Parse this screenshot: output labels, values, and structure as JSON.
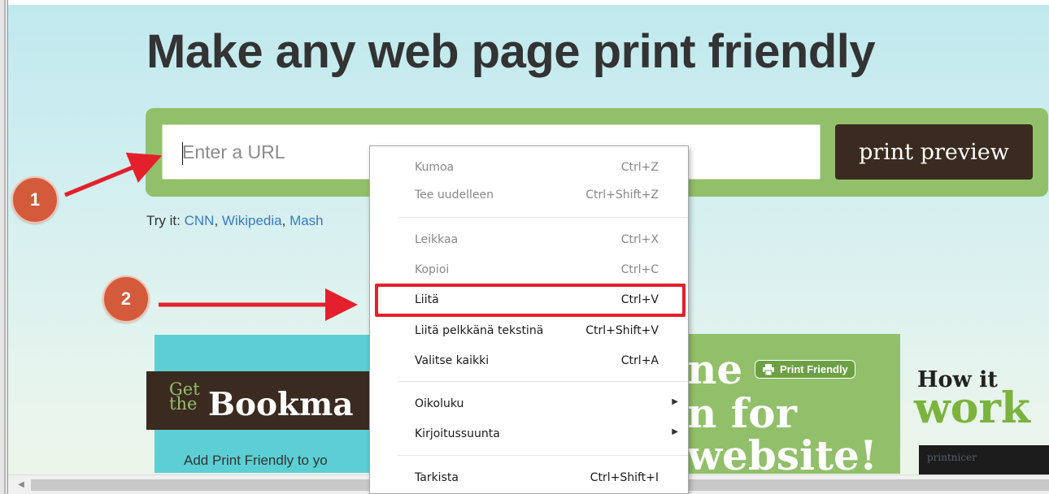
{
  "page": {
    "headline": "Make any web page print friendly",
    "url_input": {
      "placeholder": "Enter a URL",
      "value": ""
    },
    "print_preview_label": "print preview",
    "try_it": {
      "prefix": "Try it:",
      "links": [
        "CNN",
        "Wikipedia",
        "Mash"
      ],
      "separator": ", "
    }
  },
  "callouts": [
    {
      "number": "1"
    },
    {
      "number": "2"
    }
  ],
  "promos": {
    "bookmarklet": {
      "get": "Get",
      "the": "the",
      "title": "Bookma",
      "description": "Add Print Friendly to yo"
    },
    "green": {
      "line1": "ne",
      "line2": "n for",
      "line3": "website!",
      "badge": "Print Friendly",
      "badge_icon": "printer-icon"
    },
    "how_it_works": {
      "line1": "How it",
      "line2": "work",
      "strip_text": "printnicer"
    }
  },
  "context_menu": {
    "items": [
      {
        "label": "Kumoa",
        "shortcut": "Ctrl+Z",
        "disabled": true
      },
      {
        "label": "Tee uudelleen",
        "shortcut": "Ctrl+Shift+Z",
        "disabled": true
      },
      {
        "label": "Leikkaa",
        "shortcut": "Ctrl+X",
        "disabled": true
      },
      {
        "label": "Kopioi",
        "shortcut": "Ctrl+C",
        "disabled": true
      },
      {
        "label": "Liitä",
        "shortcut": "Ctrl+V",
        "disabled": false,
        "highlighted": true
      },
      {
        "label": "Liitä pelkkänä tekstinä",
        "shortcut": "Ctrl+Shift+V",
        "disabled": false
      },
      {
        "label": "Valitse kaikki",
        "shortcut": "Ctrl+A",
        "disabled": false
      },
      {
        "label": "Oikoluku",
        "submenu": true,
        "disabled": false
      },
      {
        "label": "Kirjoitussuunta",
        "submenu": true,
        "disabled": false
      },
      {
        "label": "Tarkista",
        "shortcut": "Ctrl+Shift+I",
        "disabled": false
      }
    ]
  },
  "colors": {
    "url_bar_green": "#92c06a",
    "button_brown": "#3a2a1f",
    "callout_orange": "#d35a3b",
    "annotation_red": "#e3202b",
    "bookmarklet_teal": "#5ccfd4",
    "link_blue": "#3b7abf"
  }
}
